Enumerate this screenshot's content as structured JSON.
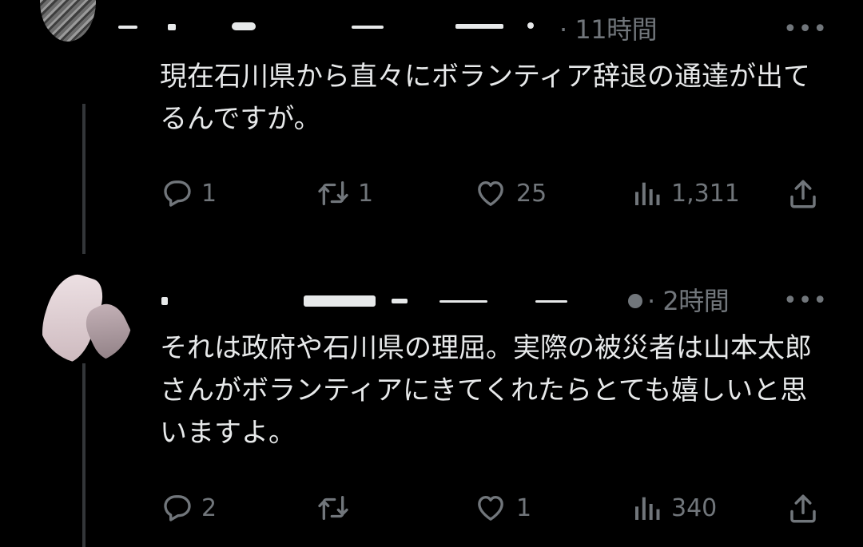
{
  "tweets": [
    {
      "time": "· 11時間",
      "more_label": "•••",
      "text": "現在石川県から直々にボランティア辞退の通達が出てるんですが。",
      "stats": {
        "replies": "1",
        "retweets": "1",
        "likes": "25",
        "views": "1,311"
      }
    },
    {
      "time": "· 2時間",
      "more_label": "•••",
      "text": "それは政府や石川県の理屈。実際の被災者は山本太郎さんがボランティアにきてくれたらとても嬉しいと思いますよ。",
      "stats": {
        "replies": "2",
        "retweets": "",
        "likes": "1",
        "views": "340"
      }
    }
  ],
  "icons": {
    "reply": "reply-icon",
    "retweet": "retweet-icon",
    "like": "heart-icon",
    "views": "analytics-icon",
    "share": "share-icon"
  },
  "colors": {
    "background": "#000000",
    "text": "#e7e9ea",
    "muted": "#71767b",
    "thread_line": "#333639"
  }
}
